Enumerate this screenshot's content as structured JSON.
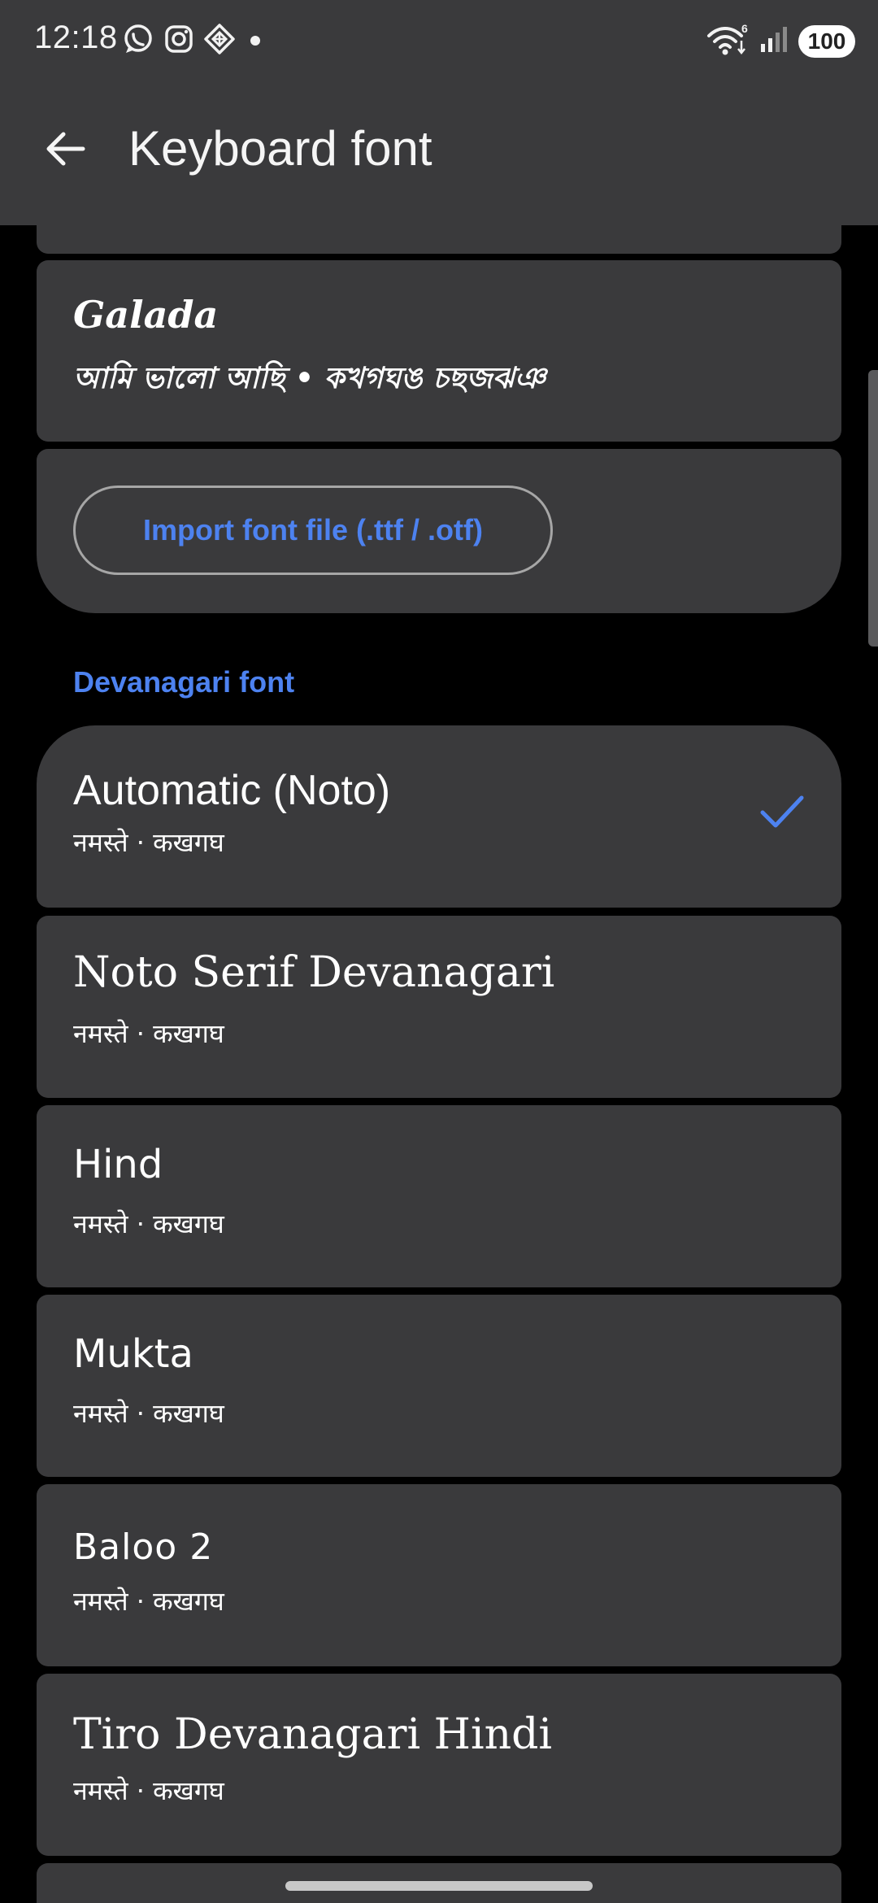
{
  "status_bar": {
    "time": "12:18",
    "left_icons": [
      "whatsapp-icon",
      "instagram-icon",
      "app-icon",
      "dot-icon"
    ],
    "right_icons": [
      "wifi-icon",
      "signal-icon"
    ],
    "wifi_badge": "6",
    "battery": "100"
  },
  "app_bar": {
    "back_icon": "arrow-left-icon",
    "title": "Keyboard font"
  },
  "bengali_fonts": {
    "items": [
      {
        "name": "Galada",
        "sample": "আমি ভালো আছি • কখগঘঙ চছজঝঞ"
      }
    ],
    "import_button": "Import font file (.ttf / .otf)"
  },
  "devanagari": {
    "section_title": "Devanagari font",
    "items": [
      {
        "name": "Automatic (Noto)",
        "sample": "नमस्ते · कखगघ",
        "selected": true
      },
      {
        "name": "Noto Serif Devanagari",
        "sample": "नमस्ते · कखगघ",
        "selected": false
      },
      {
        "name": "Hind",
        "sample": "नमस्ते · कखगघ",
        "selected": false
      },
      {
        "name": "Mukta",
        "sample": "नमस्ते · कखगघ",
        "selected": false
      },
      {
        "name": "Baloo 2",
        "sample": "नमस्ते · कखगघ",
        "selected": false
      },
      {
        "name": "Tiro Devanagari Hindi",
        "sample": "नमस्ते · कखगघ",
        "selected": false
      }
    ]
  },
  "colors": {
    "accent": "#4d82f0",
    "surface": "#3a3a3c",
    "background": "#000000"
  }
}
